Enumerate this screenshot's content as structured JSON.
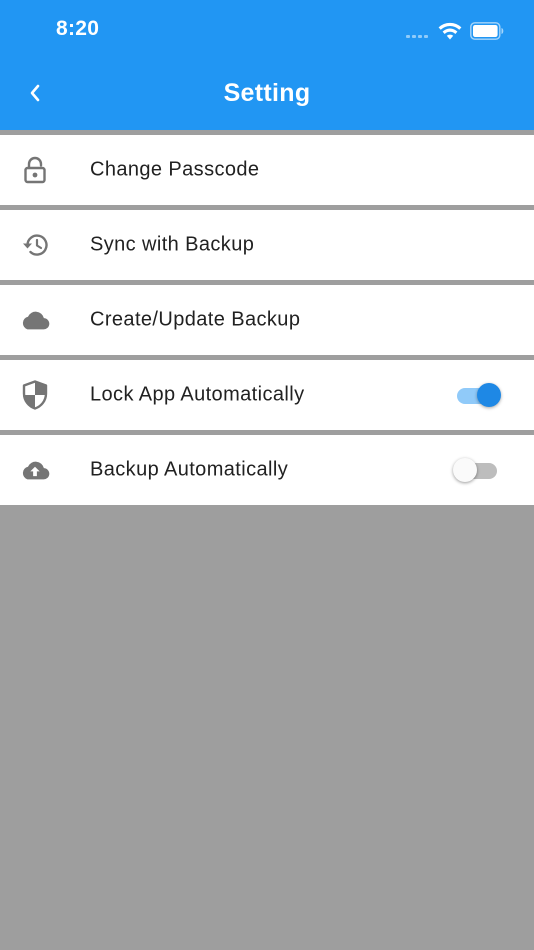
{
  "status_bar": {
    "time": "8:20",
    "icons": [
      "cellular-dots-icon",
      "wifi-icon",
      "battery-icon"
    ]
  },
  "header": {
    "title": "Setting",
    "back_icon": "chevron-left-icon"
  },
  "settings": [
    {
      "label": "Change Passcode",
      "icon": "lock-open-icon"
    },
    {
      "label": "Sync with Backup",
      "icon": "history-icon"
    },
    {
      "label": "Create/Update Backup",
      "icon": "cloud-icon"
    },
    {
      "label": "Lock App Automatically",
      "icon": "shield-icon",
      "toggle": true
    },
    {
      "label": "Backup Automatically",
      "icon": "cloud-upload-icon",
      "toggle": false
    }
  ],
  "colors": {
    "primary": "#2196f3",
    "toggle_on_thumb": "#1e88e5",
    "toggle_on_track": "#90caf9",
    "background": "#9e9e9e",
    "icon": "#757575"
  }
}
